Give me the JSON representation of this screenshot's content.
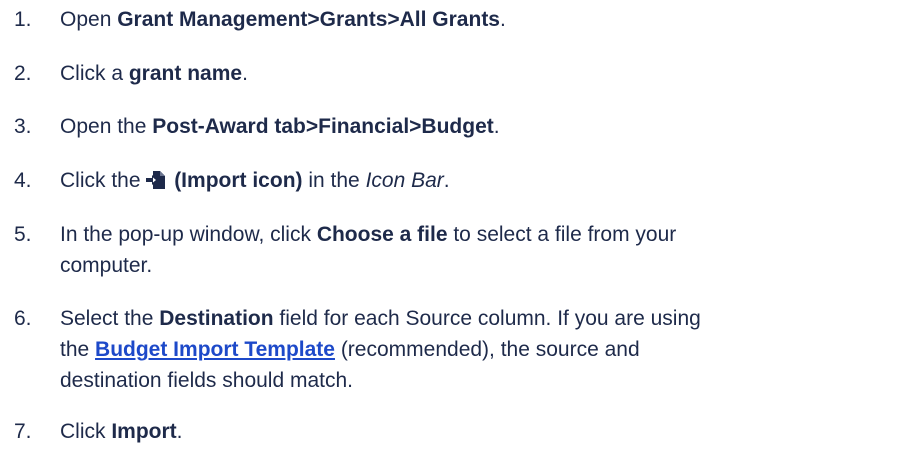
{
  "steps": [
    {
      "num": "1.",
      "t1": "Open ",
      "b1": "Grant Management>Grants>All Grants",
      "t2": "."
    },
    {
      "num": "2.",
      "t1": "Click a ",
      "b1": "grant name",
      "t2": "."
    },
    {
      "num": "3.",
      "t1": "Open the ",
      "b1": "Post-Award tab>Financial>Budget",
      "t2": "."
    },
    {
      "num": "4.",
      "t1": "Click the ",
      "icon": "import-icon",
      "b1": " (Import icon)",
      "t2": " in the ",
      "i1": "Icon Bar",
      "t3": "."
    },
    {
      "num": "5.",
      "t1": "In the pop-up window, click ",
      "b1": "Choose a file",
      "t2": " to select a file from your",
      "t3": "computer."
    },
    {
      "num": "6.",
      "t1": "Select the ",
      "b1": "Destination",
      "t2": " field for each Source column. If you are using",
      "t3": "the ",
      "link": "Budget Import Template",
      "t4": " (recommended), the source and",
      "t5": "destination fields should match."
    },
    {
      "num": "7.",
      "t1": "Click ",
      "b1": "Import",
      "t2": "."
    }
  ],
  "colors": {
    "text": "#1e2a4a",
    "link": "#1d49c9"
  }
}
